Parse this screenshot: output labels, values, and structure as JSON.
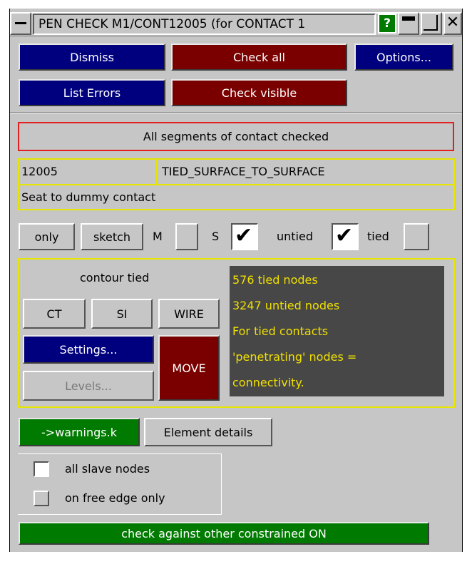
{
  "window": {
    "title": "PEN CHECK M1/CONT12005 (for CONTACT 1",
    "help_glyph": "?",
    "minimize_glyph": "▬",
    "maximize_glyph": "",
    "close_glyph": "✕"
  },
  "toolbar": {
    "dismiss": "Dismiss",
    "check_all": "Check all",
    "options": "Options...",
    "list_errors": "List Errors",
    "check_visible": "Check visible"
  },
  "status": "All segments of contact checked",
  "contact": {
    "id": "12005",
    "type": "TIED_SURFACE_TO_SURFACE",
    "title": "Seat to dummy contact"
  },
  "display_row": {
    "only": "only",
    "sketch": "sketch",
    "m": "M",
    "s": "S",
    "untied": "untied",
    "tied": "tied",
    "m_checked": false,
    "s_checked": true,
    "untied_checked": true,
    "tied_checked": false
  },
  "contour": {
    "heading": "contour tied",
    "ct": "CT",
    "si": "SI",
    "wire": "WIRE",
    "settings": "Settings...",
    "levels": "Levels...",
    "move": "MOVE"
  },
  "info": {
    "lines": [
      "576 tied nodes",
      "3247 untied nodes",
      "For tied contacts",
      "'penetrating' nodes =",
      "connectivity."
    ],
    "text_color": "#f0e000",
    "bg_color": "#474747"
  },
  "output": {
    "warnings": "->warnings.k",
    "element_details": "Element details"
  },
  "options": {
    "all_slave_nodes": "all slave nodes",
    "free_edge_only": "on free edge only",
    "all_slave_checked": false,
    "free_edge_checked": false
  },
  "constraint_toggle": "check against other constrained ON",
  "colors": {
    "blue": "#00007f",
    "red": "#7a0000",
    "green": "#007a00",
    "panel": "#c6c6c6",
    "highlight_red": "#e02020",
    "highlight_yellow": "#e6e600"
  }
}
